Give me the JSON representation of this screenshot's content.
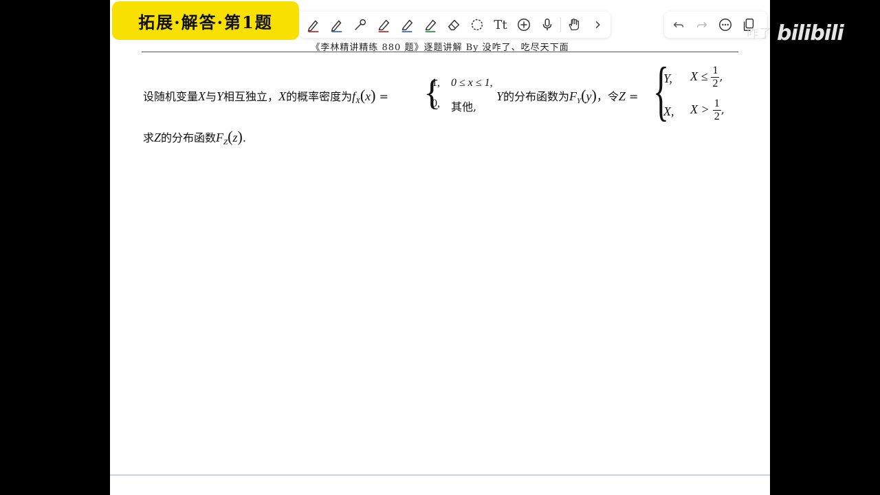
{
  "title_badge": "拓展·解答·第1题",
  "header": "《李林精讲精练 880 题》逐题讲解 By  没咋了、吃尽天下面",
  "toolbar": {
    "tools": [
      {
        "name": "pen-red-icon",
        "color": "#d0302c"
      },
      {
        "name": "pen-blue-icon",
        "color": "#3a6fd0"
      },
      {
        "name": "pen-tool-icon",
        "color": "#333333"
      },
      {
        "name": "highlighter-red-icon",
        "color": "#d0302c"
      },
      {
        "name": "highlighter-blue-icon",
        "color": "#3a6fd0"
      },
      {
        "name": "highlighter-green-icon",
        "color": "#2f9a4a"
      },
      {
        "name": "eraser-icon",
        "color": "#333333"
      },
      {
        "name": "lasso-icon",
        "color": "#333333"
      },
      {
        "name": "text-icon",
        "color": "#333333"
      },
      {
        "name": "add-icon",
        "color": "#333333"
      },
      {
        "name": "mic-icon",
        "color": "#333333"
      },
      {
        "name": "hand-icon",
        "color": "#333333"
      },
      {
        "name": "chevron-right-icon",
        "color": "#333333"
      }
    ],
    "text_tool_label": "Tt"
  },
  "problem": {
    "intro": "设随机变量",
    "var_x": "X",
    "and": "与",
    "var_y": "Y",
    "independent": "相互独立，",
    "density_text": "的概率密度为",
    "f": "f",
    "sub_x": "X",
    "arg_x": "x",
    "eq": "=",
    "case1_val": "1,",
    "case1_cond": "0 ≤ x ≤ 1,",
    "case2_val": "0,",
    "case2_cond": "其他,",
    "dist_text": "的分布函数为",
    "F": "F",
    "sub_y": "Y",
    "arg_y": "y",
    "let": "，令",
    "var_z": "Z",
    "z_case1": "Y,",
    "z_cond1": "X ≤",
    "z_case2": "X,",
    "z_cond2": "X >",
    "half_num": "1",
    "half_den": "2",
    "comma": ",",
    "ask": "求",
    "ask_dist": "的分布函数",
    "sub_z": "Z",
    "arg_z": "z",
    "period": "."
  },
  "watermark": {
    "small": "咋了",
    "logo": "bilibili"
  }
}
